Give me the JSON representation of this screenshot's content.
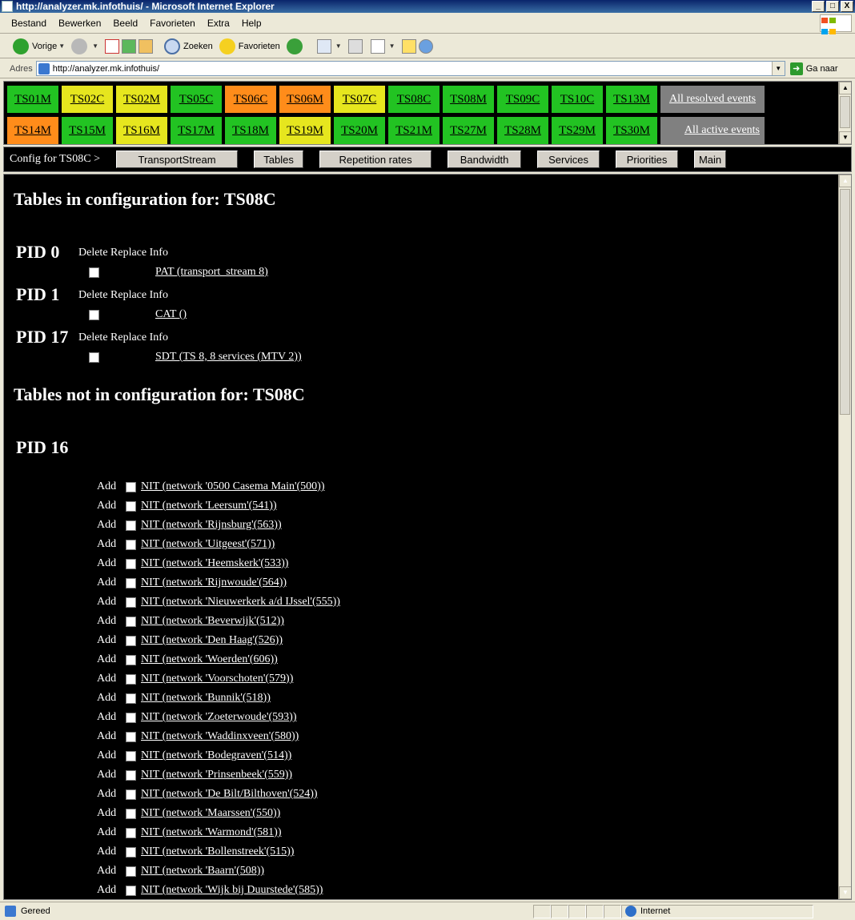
{
  "window": {
    "title": "http://analyzer.mk.infothuis/ - Microsoft Internet Explorer",
    "minimize": "_",
    "maximize": "□",
    "close": "X"
  },
  "menu": [
    "Bestand",
    "Bewerken",
    "Beeld",
    "Favorieten",
    "Extra",
    "Help"
  ],
  "toolbar": {
    "back": "Vorige",
    "search": "Zoeken",
    "favorites": "Favorieten"
  },
  "address": {
    "label": "Adres",
    "url": "http://analyzer.mk.infothuis/",
    "go": "Ga naar"
  },
  "ts_rows": [
    [
      {
        "label": "TS01M",
        "color": "#22c322"
      },
      {
        "label": "TS02C",
        "color": "#e6e61e"
      },
      {
        "label": "TS02M",
        "color": "#e6e61e"
      },
      {
        "label": "TS05C",
        "color": "#22c322"
      },
      {
        "label": "TS06C",
        "color": "#ff8c1a"
      },
      {
        "label": "TS06M",
        "color": "#ff8c1a"
      },
      {
        "label": "TS07C",
        "color": "#e6e61e"
      },
      {
        "label": "TS08C",
        "color": "#22c322"
      },
      {
        "label": "TS08M",
        "color": "#22c322"
      },
      {
        "label": "TS09C",
        "color": "#22c322"
      },
      {
        "label": "TS10C",
        "color": "#22c322"
      },
      {
        "label": "TS13M",
        "color": "#22c322"
      }
    ],
    [
      {
        "label": "TS14M",
        "color": "#ff8c1a"
      },
      {
        "label": "TS15M",
        "color": "#22c322"
      },
      {
        "label": "TS16M",
        "color": "#e6e61e"
      },
      {
        "label": "TS17M",
        "color": "#22c322"
      },
      {
        "label": "TS18M",
        "color": "#22c322"
      },
      {
        "label": "TS19M",
        "color": "#e6e61e"
      },
      {
        "label": "TS20M",
        "color": "#22c322"
      },
      {
        "label": "TS21M",
        "color": "#22c322"
      },
      {
        "label": "TS27M",
        "color": "#22c322"
      },
      {
        "label": "TS28M",
        "color": "#22c322"
      },
      {
        "label": "TS29M",
        "color": "#22c322"
      },
      {
        "label": "TS30M",
        "color": "#22c322"
      }
    ]
  ],
  "events": {
    "resolved": "All resolved events",
    "active": "All active events"
  },
  "config": {
    "label": "Config for TS08C >",
    "buttons": [
      "TransportStream",
      "Tables",
      "Repetition rates",
      "Bandwidth",
      "Services",
      "Priorities",
      "Main"
    ]
  },
  "main": {
    "in_title": "Tables in configuration for: TS08C",
    "not_in_title": "Tables not in configuration for: TS08C",
    "col_headers": "Delete Replace Info",
    "in_config": [
      {
        "pid": "PID 0",
        "table": "PAT (transport_stream 8)"
      },
      {
        "pid": "PID 1",
        "table": "CAT ()"
      },
      {
        "pid": "PID 17",
        "table": "SDT (TS 8, 8 services (MTV 2))"
      }
    ],
    "not_in_pid": "PID 16",
    "add_label": "Add",
    "not_in_config": [
      "NIT (network '0500 Casema Main'(500))",
      "NIT (network 'Leersum'(541))",
      "NIT (network 'Rijnsburg'(563))",
      "NIT (network 'Uitgeest'(571))",
      "NIT (network 'Heemskerk'(533))",
      "NIT (network 'Rijnwoude'(564))",
      "NIT (network 'Nieuwerkerk a/d IJssel'(555))",
      "NIT (network 'Beverwijk'(512))",
      "NIT (network 'Den Haag'(526))",
      "NIT (network 'Woerden'(606))",
      "NIT (network 'Voorschoten'(579))",
      "NIT (network 'Bunnik'(518))",
      "NIT (network 'Zoeterwoude'(593))",
      "NIT (network 'Waddinxveen'(580))",
      "NIT (network 'Bodegraven'(514))",
      "NIT (network 'Prinsenbeek'(559))",
      "NIT (network 'De Bilt/Bilthoven'(524))",
      "NIT (network 'Maarssen'(550))",
      "NIT (network 'Warmond'(581))",
      "NIT (network 'Bollenstreek'(515))",
      "NIT (network 'Baarn'(508))",
      "NIT (network 'Wijk bij Duurstede'(585))"
    ]
  },
  "status": {
    "left": "Gereed",
    "zone": "Internet"
  }
}
